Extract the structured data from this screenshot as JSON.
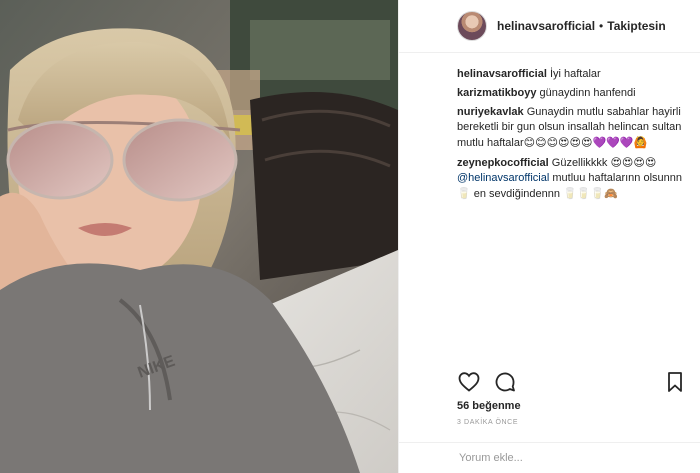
{
  "post": {
    "username": "helinavsarofficial",
    "separator": "•",
    "follow_status": "Takiptesin"
  },
  "comments": [
    {
      "user": "helinavsarofficial",
      "text": "İyi haftalar"
    },
    {
      "user": "karizmatikboyy",
      "text": "günaydinn hanfendi"
    },
    {
      "user": "nuriyekavlak",
      "text": "Gunaydin mutlu sabahlar hayirli bereketli bir gun olsun insallah helincan sultan mutlu haftalar",
      "emojis": "😊😊😊😍😍😍💜💜💜🙆"
    },
    {
      "user": "zeynepkocofficial",
      "text": "Güzellikkkk",
      "emojis": "😍😍😍😍",
      "mention": "@helinavsarofficial",
      "text2": "mutluu haftalarınn olsunnn",
      "emojis2": "🥛",
      "text3": "en sevdiğindennn",
      "emojis3": "🥛🥛🥛🙈"
    }
  ],
  "actions": {
    "like_icon": "heart-icon",
    "comment_icon": "comment-icon",
    "save_icon": "bookmark-icon"
  },
  "likes": "56 beğenme",
  "timestamp": "3 DAKİKA ÖNCE",
  "comment_placeholder": "Yorum ekle..."
}
